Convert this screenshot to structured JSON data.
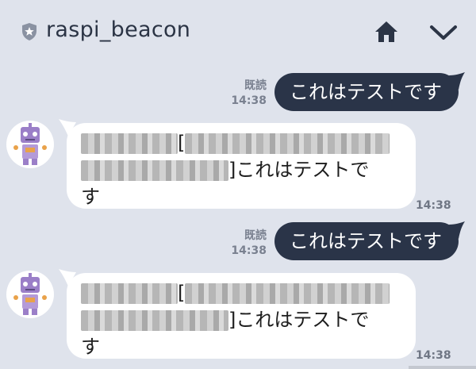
{
  "header": {
    "title": "raspi_beacon",
    "icons": {
      "badge": "shield-star-icon",
      "home": "home-icon",
      "menu": "chevron-down-icon"
    }
  },
  "messages": [
    {
      "direction": "outgoing",
      "read_label": "既読",
      "time": "14:38",
      "text": "これはテストです"
    },
    {
      "direction": "incoming",
      "text_tail": "]これはテストで",
      "text_line3": "す",
      "time": "14:38"
    },
    {
      "direction": "outgoing",
      "read_label": "既読",
      "time": "14:38",
      "text": "これはテストです"
    },
    {
      "direction": "incoming",
      "text_tail": "]これはテストで",
      "text_line3": "す",
      "time": "14:38"
    }
  ],
  "colors": {
    "background": "#dfe3ec",
    "outgoing_bubble": "#2a3448",
    "incoming_bubble": "#ffffff",
    "bot_avatar": "#9b7fc8"
  }
}
